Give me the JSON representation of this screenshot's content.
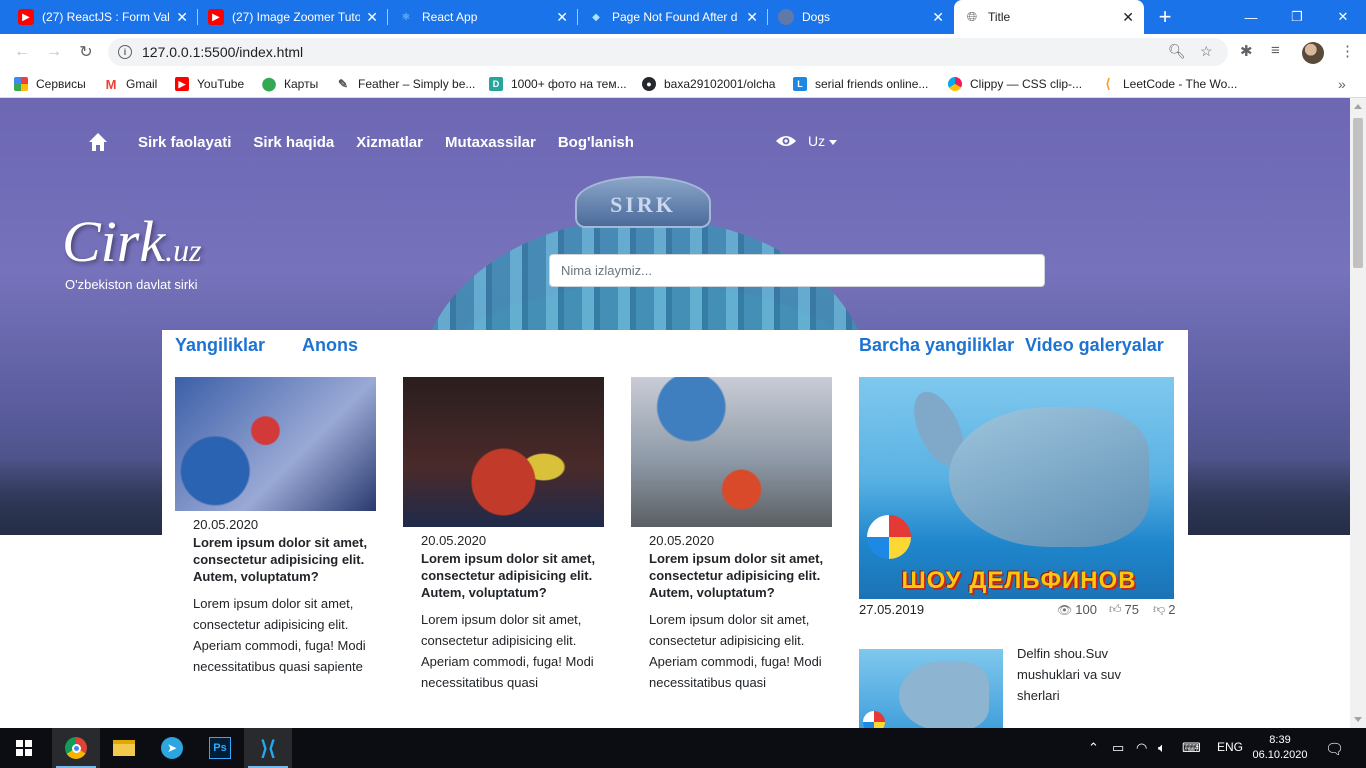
{
  "browser": {
    "tabs": [
      {
        "label": "(27) ReactJS : Form Vali",
        "favicon": "youtube-icon"
      },
      {
        "label": "(27) Image Zoomer Tuto",
        "favicon": "youtube-icon"
      },
      {
        "label": "React App",
        "favicon": "react-icon"
      },
      {
        "label": "Page Not Found After d",
        "favicon": "react-icon"
      },
      {
        "label": "Dogs",
        "favicon": "globe-icon"
      },
      {
        "label": "Title",
        "favicon": "globe-icon"
      }
    ],
    "address": "127.0.0.1:5500/index.html",
    "bookmarks": [
      "Сервисы",
      "Gmail",
      "YouTube",
      "Карты",
      "Feather – Simply be...",
      "1000+ фото на тем...",
      "baxa29102001/olcha",
      "serial friends online...",
      "Clippy — CSS clip-...",
      "LeetCode - The Wo..."
    ],
    "more_bookmarks": "»"
  },
  "site": {
    "nav": [
      "Sirk faolayati",
      "Sirk haqida",
      "Xizmatlar",
      "Mutaxassilar",
      "Bog'lanish"
    ],
    "lang": "Uz",
    "logo_main": "Cirk",
    "logo_suffix": ".uz",
    "tagline": "O'zbekiston davlat sirki",
    "search_placeholder": "Nima izlaymiz...",
    "dome_sign": "SIRK"
  },
  "panel": {
    "tabs_left": [
      "Yangiliklar",
      "Anons"
    ],
    "tabs_right": [
      "Barcha yangiliklar",
      "Video galeryalar"
    ],
    "cards": [
      {
        "date": "20.05.2020",
        "title": "Lorem ipsum dolor sit amet, consectetur adipisicing elit. Autem, voluptatum?",
        "body": "Lorem ipsum dolor sit amet, consectetur adipisicing elit. Aperiam commodi, fuga! Modi necessitatibus quasi sapiente"
      },
      {
        "date": "20.05.2020",
        "title": "Lorem ipsum dolor sit amet, consectetur adipisicing elit. Autem, voluptatum?",
        "body": "Lorem ipsum dolor sit amet, consectetur adipisicing elit. Aperiam commodi, fuga! Modi necessitatibus quasi"
      },
      {
        "date": "20.05.2020",
        "title": "Lorem ipsum dolor sit amet, consectetur adipisicing elit. Autem, voluptatum?",
        "body": "Lorem ipsum dolor sit amet, consectetur adipisicing elit. Aperiam commodi, fuga! Modi necessitatibus quasi"
      }
    ],
    "featured": {
      "banner": "ШОУ ДЕЛЬФИНОВ",
      "date": "27.05.2019",
      "views": "100",
      "likes": "75",
      "dislikes": "2"
    },
    "side_item": "Delfin shou.Suv mushuklari va suv sherlari"
  },
  "taskbar": {
    "lang": "ENG",
    "time": "8:39",
    "date": "06.10.2020"
  },
  "colors": {
    "chrome_blue": "#1a73e8",
    "link_blue": "#1e73d2",
    "hero_purple": "#6d67b4"
  }
}
